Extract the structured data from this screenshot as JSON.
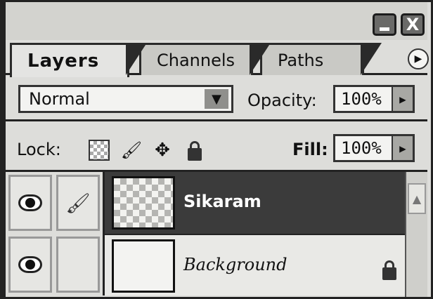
{
  "window": {
    "minimize_label": "_",
    "close_label": "X"
  },
  "tabs": [
    {
      "label": "Layers",
      "active": true
    },
    {
      "label": "Channels",
      "active": false
    },
    {
      "label": "Paths",
      "active": false
    }
  ],
  "tab_menu_icon": "play-right-icon",
  "blend": {
    "mode": "Normal",
    "opacity_label": "Opacity:",
    "opacity_value": "100%"
  },
  "lock": {
    "label": "Lock:",
    "icons": [
      "lock-transparency-icon",
      "lock-paint-icon",
      "lock-move-icon",
      "lock-all-icon"
    ],
    "fill_label": "Fill:",
    "fill_value": "100%"
  },
  "layers": [
    {
      "name": "Sikaram",
      "visible": true,
      "selected": true,
      "thumbnail": "transparent"
    },
    {
      "name": "Background",
      "visible": true,
      "selected": false,
      "thumbnail": "white",
      "locked": true
    }
  ],
  "colors": {
    "selected_row": "#3b3b3b",
    "panel": "#ddddda"
  }
}
